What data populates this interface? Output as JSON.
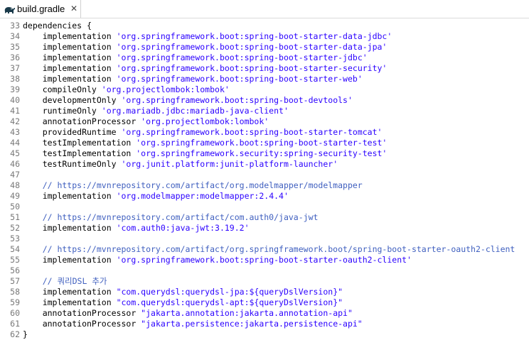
{
  "tab": {
    "title": "build.gradle",
    "close": "✕",
    "icon": "gradle-elephant-icon"
  },
  "colors": {
    "keyword": "#000000",
    "string": "#2a00ff",
    "comment": "#3f5fbf",
    "line_number": "#787878"
  },
  "lines": [
    {
      "n": "33",
      "a": "dependencies {",
      "b": "",
      "t": "plain"
    },
    {
      "n": "34",
      "a": "    implementation ",
      "b": "'org.springframework.boot:spring-boot-starter-data-jdbc'",
      "t": "str"
    },
    {
      "n": "35",
      "a": "    implementation ",
      "b": "'org.springframework.boot:spring-boot-starter-data-jpa'",
      "t": "str"
    },
    {
      "n": "36",
      "a": "    implementation ",
      "b": "'org.springframework.boot:spring-boot-starter-jdbc'",
      "t": "str"
    },
    {
      "n": "37",
      "a": "    implementation ",
      "b": "'org.springframework.boot:spring-boot-starter-security'",
      "t": "str"
    },
    {
      "n": "38",
      "a": "    implementation ",
      "b": "'org.springframework.boot:spring-boot-starter-web'",
      "t": "str"
    },
    {
      "n": "39",
      "a": "    compileOnly ",
      "b": "'org.projectlombok:lombok'",
      "t": "str"
    },
    {
      "n": "40",
      "a": "    developmentOnly ",
      "b": "'org.springframework.boot:spring-boot-devtools'",
      "t": "str"
    },
    {
      "n": "41",
      "a": "    runtimeOnly ",
      "b": "'org.mariadb.jdbc:mariadb-java-client'",
      "t": "str"
    },
    {
      "n": "42",
      "a": "    annotationProcessor ",
      "b": "'org.projectlombok:lombok'",
      "t": "str"
    },
    {
      "n": "43",
      "a": "    providedRuntime ",
      "b": "'org.springframework.boot:spring-boot-starter-tomcat'",
      "t": "str"
    },
    {
      "n": "44",
      "a": "    testImplementation ",
      "b": "'org.springframework.boot:spring-boot-starter-test'",
      "t": "str"
    },
    {
      "n": "45",
      "a": "    testImplementation ",
      "b": "'org.springframework.security:spring-security-test'",
      "t": "str"
    },
    {
      "n": "46",
      "a": "    testRuntimeOnly ",
      "b": "'org.junit.platform:junit-platform-launcher'",
      "t": "str"
    },
    {
      "n": "47",
      "a": "",
      "b": "",
      "t": "plain"
    },
    {
      "n": "48",
      "a": "    // https://mvnrepository.com/artifact/org.modelmapper/modelmapper",
      "b": "",
      "t": "cmt"
    },
    {
      "n": "49",
      "a": "    implementation ",
      "b": "'org.modelmapper:modelmapper:2.4.4'",
      "t": "str"
    },
    {
      "n": "50",
      "a": "",
      "b": "",
      "t": "plain"
    },
    {
      "n": "51",
      "a": "    // https://mvnrepository.com/artifact/com.auth0/java-jwt",
      "b": "",
      "t": "cmt"
    },
    {
      "n": "52",
      "a": "    implementation ",
      "b": "'com.auth0:java-jwt:3.19.2'",
      "t": "str"
    },
    {
      "n": "53",
      "a": "",
      "b": "",
      "t": "plain"
    },
    {
      "n": "54",
      "a": "    // https://mvnrepository.com/artifact/org.springframework.boot/spring-boot-starter-oauth2-client",
      "b": "",
      "t": "cmt"
    },
    {
      "n": "55",
      "a": "    implementation ",
      "b": "'org.springframework.boot:spring-boot-starter-oauth2-client'",
      "t": "str"
    },
    {
      "n": "56",
      "a": "",
      "b": "",
      "t": "plain"
    },
    {
      "n": "57",
      "a": "    // 쿼리DSL 추가",
      "b": "",
      "t": "cmt"
    },
    {
      "n": "58",
      "a": "    implementation ",
      "b": "\"com.querydsl:querydsl-jpa:${queryDslVersion}\"",
      "t": "str"
    },
    {
      "n": "59",
      "a": "    implementation ",
      "b": "\"com.querydsl:querydsl-apt:${queryDslVersion}\"",
      "t": "str"
    },
    {
      "n": "60",
      "a": "    annotationProcessor ",
      "b": "\"jakarta.annotation:jakarta.annotation-api\"",
      "t": "str"
    },
    {
      "n": "61",
      "a": "    annotationProcessor ",
      "b": "\"jakarta.persistence:jakarta.persistence-api\"",
      "t": "str"
    },
    {
      "n": "62",
      "a": "}",
      "b": "",
      "t": "plain"
    }
  ]
}
